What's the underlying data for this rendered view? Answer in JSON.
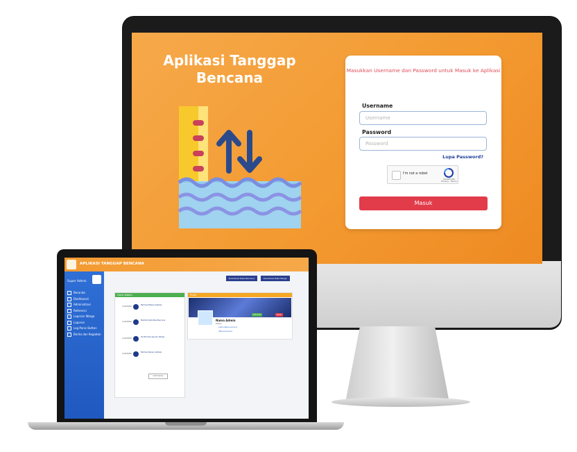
{
  "login": {
    "app_title": "Aplikasi Tanggap Bencana",
    "message": "Masukkan Username dan Password untuk Masuk ke Aplikasi",
    "username_label": "Username",
    "username_placeholder": "Username",
    "password_label": "Password",
    "password_placeholder": "Password",
    "forgot_link": "Lupa Password?",
    "captcha_text": "I'm not a robot",
    "captcha_brand": "reCAPTCHA Privacy - Terms",
    "submit_label": "Masuk"
  },
  "dashboard": {
    "header_title": "APLIKASI TANGGAP BENCANA",
    "user_name": "Super Admin",
    "menu": [
      "Beranda",
      "Dashboard",
      "Administrasi",
      "Referensi",
      "Laporan Warga",
      "Laporan",
      "Log Panic Button",
      "Berita dan Kegiatan"
    ],
    "download_buttons": [
      "Download Data Bencana",
      "Download Data Warga"
    ],
    "activity_card_title": "Garis Waktu",
    "timeline": [
      {
        "date": "11/02/2020",
        "text": "Berhasil Masuk Aplikasi"
      },
      {
        "date": "11/02/2020",
        "text": "Melihat Data Peta Bencana"
      },
      {
        "date": "11/02/2020",
        "text": "Konfirmasi Laporan Warga"
      },
      {
        "date": "11/02/2020",
        "text": "Berhasil Keluar Aplikasi"
      }
    ],
    "timeline_more": "Lihat Semua",
    "profile_card_title": "Profil",
    "profile_name": "Nama Admin",
    "profile_role": "Admin",
    "profile_email": "admin@bencana.id",
    "profile_phone": "08xxxxxxxxxx",
    "profile_buttons": [
      "Edit Profil",
      "Keluar"
    ]
  }
}
